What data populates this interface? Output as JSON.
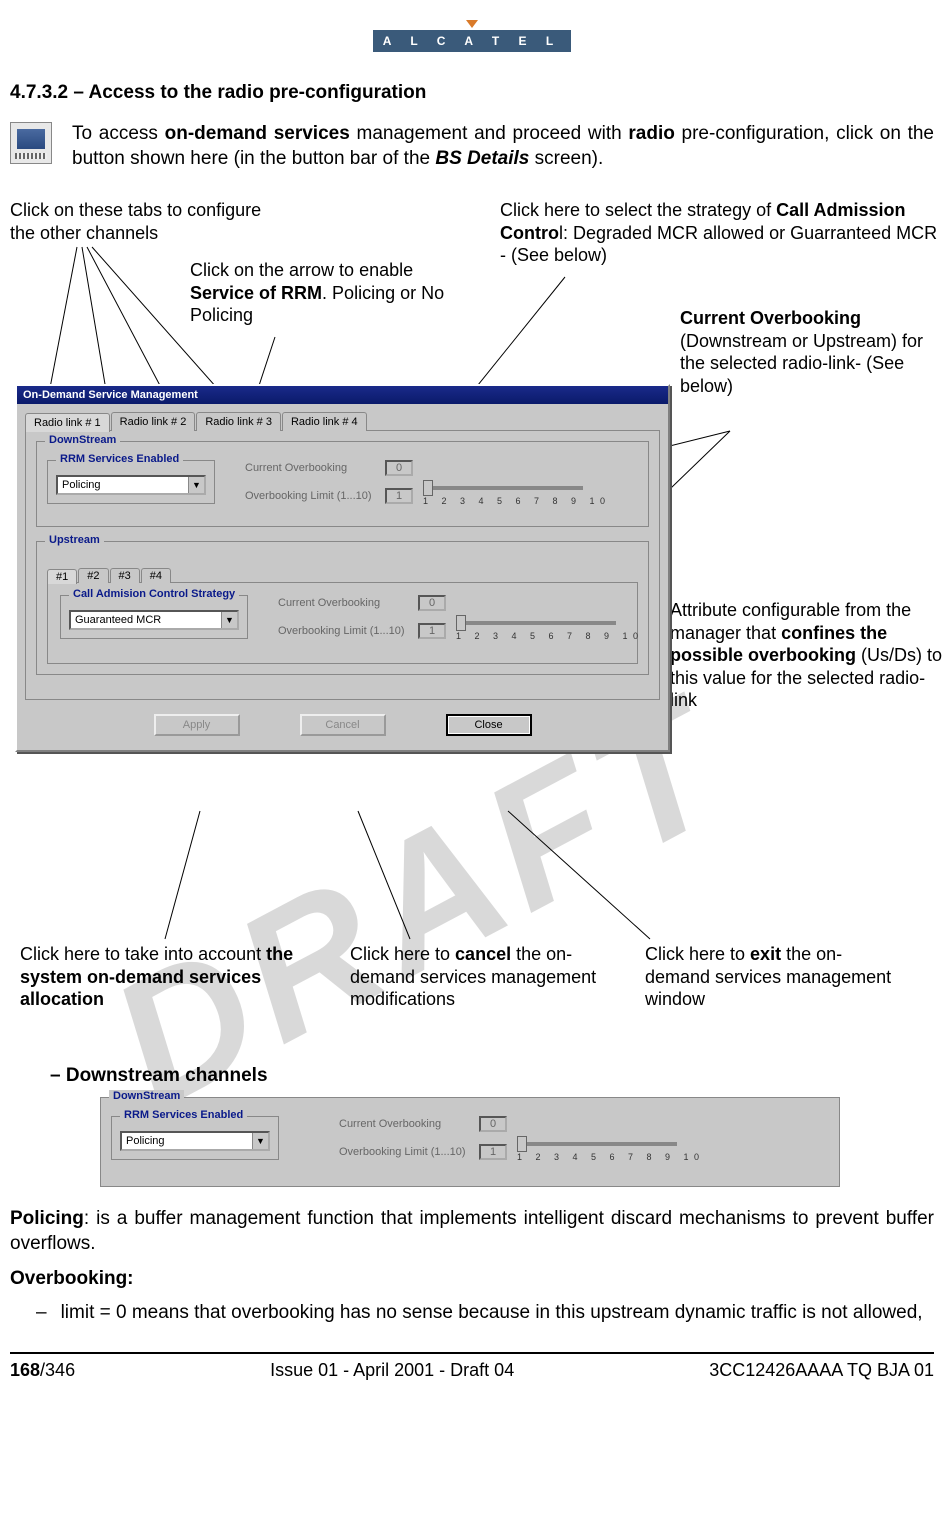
{
  "logo": {
    "text": "A L C A T E L"
  },
  "heading": "4.7.3.2 –   Access to the radio pre-configuration",
  "intro": {
    "pre": "To access ",
    "b1": "on-demand services",
    "mid1": " management and proceed with ",
    "b2": "radio",
    "mid2": " pre-configuration, click on the button shown here (in the button bar of the ",
    "bi1": "BS Details",
    "post": " screen)."
  },
  "callouts": {
    "c1": "Click on these tabs to configure the other channels",
    "c2_pre": "Click on the arrow to enable ",
    "c2_b": "Service of RRM",
    "c2_post": ". Policing or No Policing",
    "c3_pre": "Click here to select the strategy of ",
    "c3_b": "Call Admission Contro",
    "c3_post": "l: Degraded MCR allowed or Guarranteed MCR - (See below)",
    "c4_b": "Current Overbooking",
    "c4_post": " (Downstream or Upstream) for the selected radio-link- (See below)",
    "c5_pre": "Attribute configurable from the manager that ",
    "c5_b": "confines the possible overbooking",
    "c5_post": " (Us/Ds) to this value for the selected radio-link",
    "c6_pre": "Click here to  take into account ",
    "c6_b": "the system on-demand services allocation",
    "c7_pre": "Click here to ",
    "c7_b": "cancel",
    "c7_post": " the on-demand services management modifications",
    "c8_pre": "Click here to ",
    "c8_b": "exit",
    "c8_post": " the on-demand services management window"
  },
  "window": {
    "title": "On-Demand Service Management",
    "tabs": [
      "Radio link # 1",
      "Radio link # 2",
      "Radio link # 3",
      "Radio link # 4"
    ],
    "downstream_label": "DownStream",
    "rrm_label": "RRM Services Enabled",
    "rrm_value": "Policing",
    "metric1": "Current Overbooking",
    "metric1_val": "0",
    "metric2": "Overbooking Limit (1...10)",
    "metric2_val": "1",
    "ticks": "1 2 3 4 5 6 7 8 9 10",
    "upstream_label": "Upstream",
    "subtabs": [
      "#1",
      "#2",
      "#3",
      "#4"
    ],
    "cac_label": "Call Admision Control Strategy",
    "cac_value": "Guaranteed MCR",
    "buttons": {
      "apply": "Apply",
      "cancel": "Cancel",
      "close": "Close"
    }
  },
  "watermark": "DRAFT",
  "sub_heading": "–    Downstream channels",
  "policing": {
    "b": "Policing",
    "rest": ": is a buffer management function that implements intelligent discard mechanisms to prevent buffer overflows."
  },
  "overbooking_h": "Overbooking:",
  "overbooking_b1": "limit = 0 means that overbooking has no sense because in this upstream dynamic traffic is not allowed,",
  "footer": {
    "page_b": "168",
    "page_rest": "/346",
    "center": "Issue 01 - April 2001 - Draft 04",
    "right": "3CC12426AAAA TQ BJA 01"
  }
}
